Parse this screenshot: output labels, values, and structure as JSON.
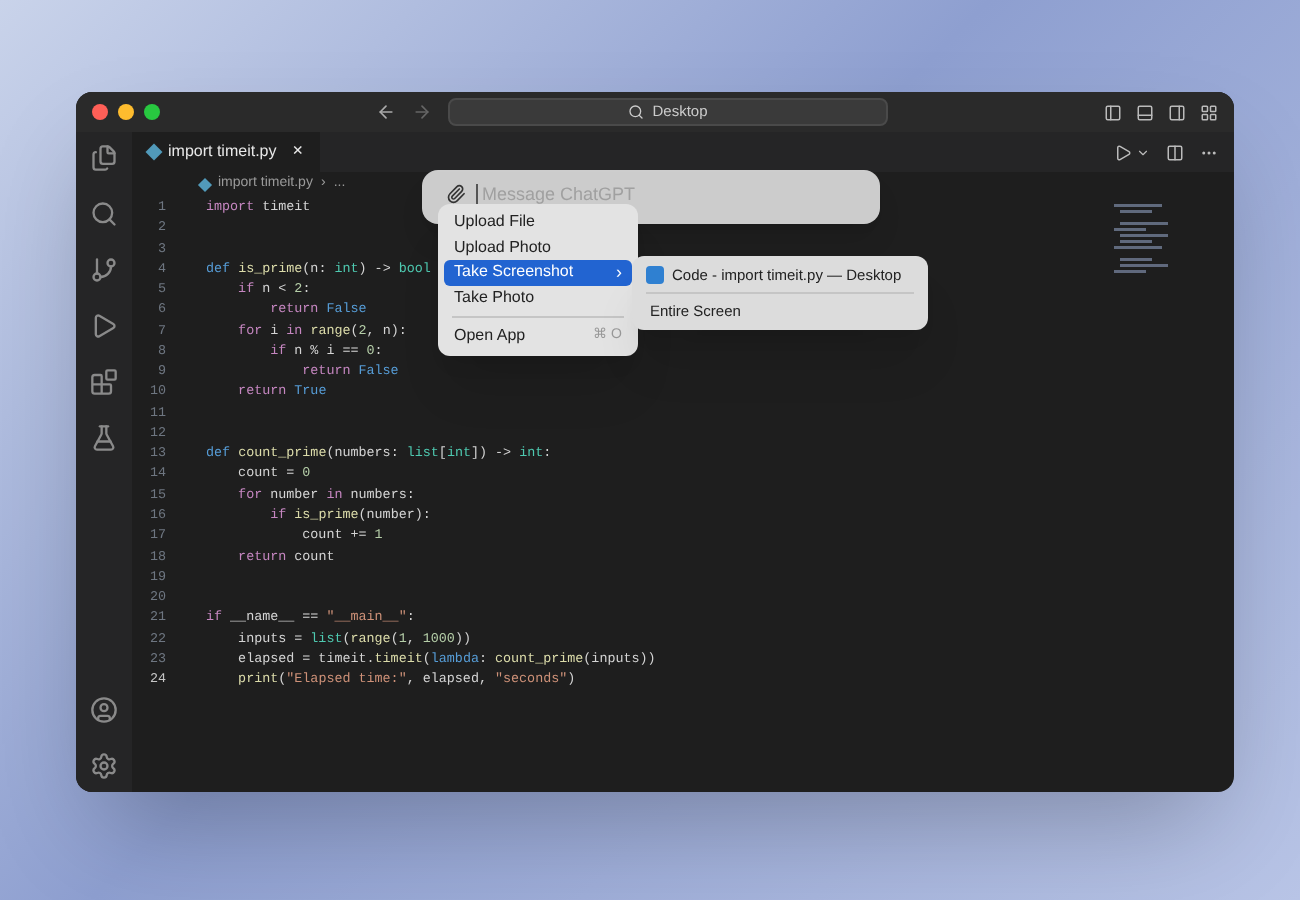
{
  "titlebar": {
    "search": "Desktop"
  },
  "tabs": [
    {
      "label": "import timeit.py",
      "selected": true,
      "close": "×"
    }
  ],
  "breadcrumb": [
    "import timeit.py",
    "›",
    "..."
  ],
  "code": [
    {
      "n": "1",
      "tokens": [
        {
          "kind": "kw",
          "text": "import "
        },
        {
          "kind": "plain",
          "text": "timeit"
        }
      ]
    },
    {
      "n": "2"
    },
    {
      "n": "3"
    },
    {
      "n": "4",
      "tokens": [
        {
          "kind": "def",
          "text": "def "
        },
        {
          "kind": "fn",
          "text": "is_prime"
        },
        {
          "kind": "plain",
          "text": "(n: "
        },
        {
          "kind": "type",
          "text": "int"
        },
        {
          "kind": "plain",
          "text": ") -> "
        },
        {
          "kind": "type",
          "text": "bool"
        }
      ]
    },
    {
      "n": "5",
      "tokens": [
        {
          "kind": "kw",
          "text": "    if"
        },
        {
          "kind": "plain",
          "text": " n < "
        },
        {
          "kind": "num",
          "text": "2"
        },
        {
          "kind": "plain",
          "text": ":"
        }
      ]
    },
    {
      "n": "6",
      "tokens": [
        {
          "kind": "kw",
          "text": "        return "
        },
        {
          "kind": "def",
          "text": "False"
        }
      ]
    },
    {
      "n": "7",
      "tokens": [
        {
          "kind": "kw",
          "text": "    for"
        },
        {
          "kind": "plain",
          "text": " i "
        },
        {
          "kind": "kw",
          "text": "in "
        },
        {
          "kind": "fn",
          "text": "range"
        },
        {
          "kind": "plain",
          "text": "("
        },
        {
          "kind": "num",
          "text": "2"
        },
        {
          "kind": "plain",
          "text": ", n):"
        }
      ]
    },
    {
      "n": "8",
      "tokens": [
        {
          "kind": "kw",
          "text": "        if"
        },
        {
          "kind": "plain",
          "text": " n % i == "
        },
        {
          "kind": "num",
          "text": "0"
        },
        {
          "kind": "plain",
          "text": ":"
        }
      ]
    },
    {
      "n": "9",
      "tokens": [
        {
          "kind": "kw",
          "text": "            return "
        },
        {
          "kind": "def",
          "text": "False"
        }
      ]
    },
    {
      "n": "10",
      "tokens": [
        {
          "kind": "kw",
          "text": "    return "
        },
        {
          "kind": "def",
          "text": "True"
        }
      ]
    },
    {
      "n": "11"
    },
    {
      "n": "12"
    },
    {
      "n": "13",
      "tokens": [
        {
          "kind": "def",
          "text": "def "
        },
        {
          "kind": "fn",
          "text": "count_prime"
        },
        {
          "kind": "plain",
          "text": "(numbers: "
        },
        {
          "kind": "type",
          "text": "list"
        },
        {
          "kind": "plain",
          "text": "["
        },
        {
          "kind": "type",
          "text": "int"
        },
        {
          "kind": "plain",
          "text": "]) -> "
        },
        {
          "kind": "type",
          "text": "int"
        },
        {
          "kind": "plain",
          "text": ":"
        }
      ]
    },
    {
      "n": "14",
      "tokens": [
        {
          "kind": "plain",
          "text": "    count = "
        },
        {
          "kind": "num",
          "text": "0"
        }
      ]
    },
    {
      "n": "15",
      "tokens": [
        {
          "kind": "kw",
          "text": "    for"
        },
        {
          "kind": "plain",
          "text": " number "
        },
        {
          "kind": "kw",
          "text": "in"
        },
        {
          "kind": "plain",
          "text": " numbers:"
        }
      ]
    },
    {
      "n": "16",
      "tokens": [
        {
          "kind": "kw",
          "text": "        if "
        },
        {
          "kind": "fn",
          "text": "is_prime"
        },
        {
          "kind": "plain",
          "text": "(number):"
        }
      ]
    },
    {
      "n": "17",
      "tokens": [
        {
          "kind": "plain",
          "text": "            count += "
        },
        {
          "kind": "num",
          "text": "1"
        }
      ]
    },
    {
      "n": "18",
      "tokens": [
        {
          "kind": "kw",
          "text": "    return"
        },
        {
          "kind": "plain",
          "text": " count"
        }
      ]
    },
    {
      "n": "19"
    },
    {
      "n": "20"
    },
    {
      "n": "21",
      "tokens": [
        {
          "kind": "kw",
          "text": "if"
        },
        {
          "kind": "plain",
          "text": " __name__ == "
        },
        {
          "kind": "str",
          "text": "\"__main__\""
        },
        {
          "kind": "plain",
          "text": ":"
        }
      ]
    },
    {
      "n": "22",
      "tokens": [
        {
          "kind": "plain",
          "text": "    inputs = "
        },
        {
          "kind": "type",
          "text": "list"
        },
        {
          "kind": "plain",
          "text": "("
        },
        {
          "kind": "fn",
          "text": "range"
        },
        {
          "kind": "plain",
          "text": "("
        },
        {
          "kind": "num",
          "text": "1"
        },
        {
          "kind": "plain",
          "text": ", "
        },
        {
          "kind": "num",
          "text": "1000"
        },
        {
          "kind": "plain",
          "text": "))"
        }
      ]
    },
    {
      "n": "23",
      "tokens": [
        {
          "kind": "plain",
          "text": "    elapsed = timeit."
        },
        {
          "kind": "fn",
          "text": "timeit"
        },
        {
          "kind": "plain",
          "text": "("
        },
        {
          "kind": "def",
          "text": "lambda"
        },
        {
          "kind": "plain",
          "text": ": "
        },
        {
          "kind": "fn",
          "text": "count_prime"
        },
        {
          "kind": "plain",
          "text": "(inputs))"
        }
      ]
    },
    {
      "n": "24",
      "tokens": [
        {
          "kind": "fn",
          "text": "    print"
        },
        {
          "kind": "plain",
          "text": "("
        },
        {
          "kind": "str",
          "text": "\"Elapsed time:\""
        },
        {
          "kind": "plain",
          "text": ", elapsed, "
        },
        {
          "kind": "str",
          "text": "\"seconds\""
        },
        {
          "kind": "plain",
          "text": ")"
        }
      ]
    }
  ],
  "chat_input": {
    "placeholder": "Message ChatGPT"
  },
  "menu": [
    {
      "kind": "item",
      "label": "Upload File",
      "selected": false
    },
    {
      "kind": "item",
      "label": "Upload Photo",
      "selected": false
    },
    {
      "kind": "submenu",
      "label": "Take Screenshot",
      "selected": true,
      "arrow": "›"
    },
    {
      "kind": "item",
      "label": "Take Photo",
      "selected": false
    },
    {
      "kind": "separator"
    },
    {
      "kind": "item",
      "label": "Open App",
      "selected": false,
      "shortcut": "⌘ O"
    }
  ],
  "submenu": [
    {
      "kind": "app",
      "label": "Code - import timeit.py — Desktop"
    },
    {
      "kind": "separator"
    },
    {
      "kind": "item",
      "label": "Entire Screen"
    }
  ]
}
